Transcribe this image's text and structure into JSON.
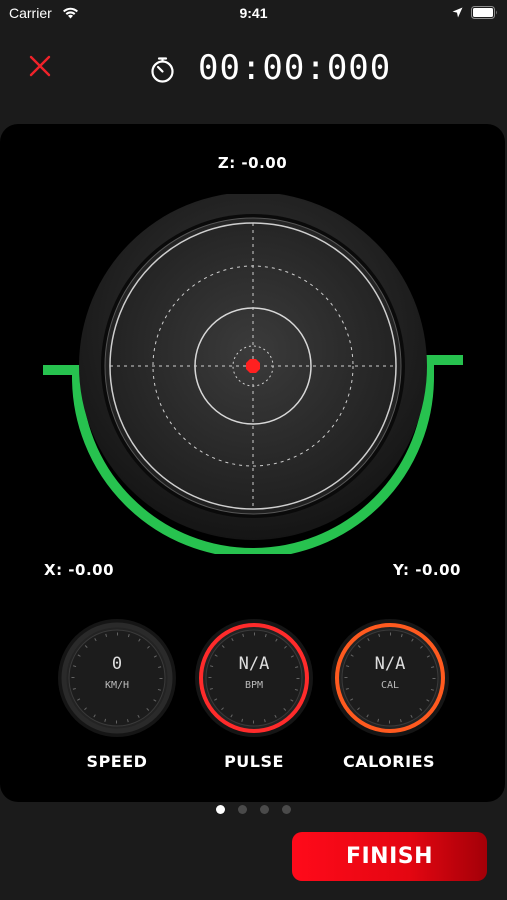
{
  "status_bar": {
    "carrier": "Carrier",
    "time": "9:41",
    "icons": [
      "wifi-icon",
      "location-arrow-icon",
      "battery-icon"
    ]
  },
  "header": {
    "close_icon": "close-icon",
    "stopwatch_icon": "stopwatch-icon",
    "timer": "00:00:000"
  },
  "tilt": {
    "z_label": "Z: -0.00",
    "x_label": "X: -0.00",
    "y_label": "Y: -0.00",
    "indicator_color": "#ff2020",
    "bracket_color": "#27c24f"
  },
  "gauges": [
    {
      "title": "SPEED",
      "value": "0",
      "unit": "KM/H",
      "ring_color": "#2a2a2a"
    },
    {
      "title": "PULSE",
      "value": "N/A",
      "unit": "BPM",
      "ring_color": "#ff2b2b"
    },
    {
      "title": "CALORIES",
      "value": "N/A",
      "unit": "CAL",
      "ring_color": "#ff5a1f"
    }
  ],
  "pager": {
    "count": 4,
    "active": 0,
    "active_color": "#ffffff",
    "inactive_color": "#4a4a4a"
  },
  "finish": {
    "label": "FINISH",
    "color": "#ff0a1a"
  }
}
